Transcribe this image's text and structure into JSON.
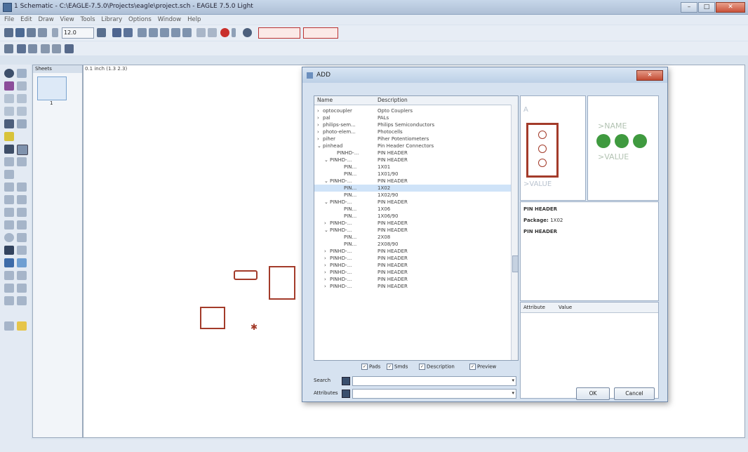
{
  "window": {
    "title": "1 Schematic - C:\\EAGLE-7.5.0\\Projects\\eagle\\project.sch - EAGLE 7.5.0 Light",
    "min_label": "–",
    "max_label": "□",
    "close_label": "✕"
  },
  "menu": [
    "File",
    "Edit",
    "Draw",
    "View",
    "Tools",
    "Library",
    "Options",
    "Window",
    "Help"
  ],
  "toolbar": {
    "grid_combo": "12.0",
    "layer_combo_1": "",
    "layer_combo_2": ""
  },
  "sheet_panel": {
    "header": "Sheets",
    "sheet_number": "1",
    "coord": "0.1 inch (1.3 2.3)"
  },
  "dialog": {
    "title": "ADD",
    "columns": {
      "name": "Name",
      "description": "Description"
    },
    "rows": [
      {
        "name": "optocoupler",
        "desc": "Opto Couplers",
        "indent": 0,
        "expand": "›"
      },
      {
        "name": "pal",
        "desc": "PALs",
        "indent": 0,
        "expand": "›"
      },
      {
        "name": "philips-sem...",
        "desc": "Philips Semiconductors",
        "indent": 0,
        "expand": "›"
      },
      {
        "name": "photo-elem...",
        "desc": "Photocells",
        "indent": 0,
        "expand": "›"
      },
      {
        "name": "piher",
        "desc": "Piher Potentiometers",
        "indent": 0,
        "expand": "›"
      },
      {
        "name": "pinhead",
        "desc": "Pin Header Connectors",
        "indent": 0,
        "expand": "⌄"
      },
      {
        "name": "PINHD-...",
        "desc": "PIN HEADER",
        "indent": 2,
        "expand": ""
      },
      {
        "name": "PINHD-...",
        "desc": "PIN HEADER",
        "indent": 1,
        "expand": "⌄"
      },
      {
        "name": "PIN...",
        "desc": "1X01",
        "indent": 3,
        "expand": ""
      },
      {
        "name": "PIN...",
        "desc": "1X01/90",
        "indent": 3,
        "expand": ""
      },
      {
        "name": "PINHD-...",
        "desc": "PIN HEADER",
        "indent": 1,
        "expand": "⌄"
      },
      {
        "name": "PIN...",
        "desc": "1X02",
        "indent": 3,
        "expand": "",
        "selected": true
      },
      {
        "name": "PIN...",
        "desc": "1X02/90",
        "indent": 3,
        "expand": ""
      },
      {
        "name": "PINHD-...",
        "desc": "PIN HEADER",
        "indent": 1,
        "expand": "⌄"
      },
      {
        "name": "PIN...",
        "desc": "1X06",
        "indent": 3,
        "expand": ""
      },
      {
        "name": "PIN...",
        "desc": "1X06/90",
        "indent": 3,
        "expand": ""
      },
      {
        "name": "PINHD-...",
        "desc": "PIN HEADER",
        "indent": 1,
        "expand": "›"
      },
      {
        "name": "PINHD-...",
        "desc": "PIN HEADER",
        "indent": 1,
        "expand": "⌄"
      },
      {
        "name": "PIN...",
        "desc": "2X08",
        "indent": 3,
        "expand": ""
      },
      {
        "name": "PIN...",
        "desc": "2X08/90",
        "indent": 3,
        "expand": ""
      },
      {
        "name": "PINHD-...",
        "desc": "PIN HEADER",
        "indent": 1,
        "expand": "›"
      },
      {
        "name": "PINHD-...",
        "desc": "PIN HEADER",
        "indent": 1,
        "expand": "›"
      },
      {
        "name": "PINHD-...",
        "desc": "PIN HEADER",
        "indent": 1,
        "expand": "›"
      },
      {
        "name": "PINHD-...",
        "desc": "PIN HEADER",
        "indent": 1,
        "expand": "›"
      },
      {
        "name": "PINHD-...",
        "desc": "PIN HEADER",
        "indent": 1,
        "expand": "›"
      },
      {
        "name": "PINHD-...",
        "desc": "PIN HEADER",
        "indent": 1,
        "expand": "›"
      }
    ],
    "checks": {
      "pads": "Pads",
      "smds": "Smds",
      "description": "Description",
      "preview": "Preview"
    },
    "search_label": "Search",
    "attributes_label": "Attributes",
    "symbol_preview": {
      "name": ">NAME",
      "value": ">VALUE",
      "ref": "A"
    },
    "package_preview": {
      "name": ">NAME",
      "value": ">VALUE"
    },
    "details": {
      "line1": "PIN HEADER",
      "line2_label": "Package:",
      "line2_value": "1X02",
      "line3": "PIN HEADER"
    },
    "attr_table": {
      "attribute": "Attribute",
      "value": "Value"
    },
    "ok_label": "OK",
    "cancel_label": "Cancel"
  }
}
